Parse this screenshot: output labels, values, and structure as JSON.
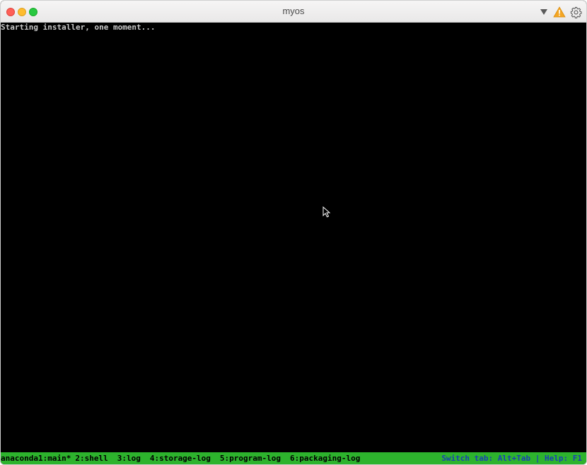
{
  "window": {
    "title": "myos"
  },
  "titlebar": {
    "icons": [
      "dropdown-arrow-icon",
      "warning-icon",
      "gear-icon"
    ]
  },
  "console": {
    "lines": [
      "Starting installer, one moment..."
    ]
  },
  "statusbar": {
    "tabs": [
      {
        "label": "anaconda1:main*",
        "active": true
      },
      {
        "label": "2:shell"
      },
      {
        "label": "3:log"
      },
      {
        "label": "4:storage-log"
      },
      {
        "label": "5:program-log"
      },
      {
        "label": "6:packaging-log"
      }
    ],
    "help_text": "Switch tab: Alt+Tab | Help: F1"
  },
  "colors": {
    "terminal_bg": "#000000",
    "statusbar_bg": "#2db32d",
    "help_text": "#1a3fb5",
    "console_text": "#c8c8c8"
  }
}
